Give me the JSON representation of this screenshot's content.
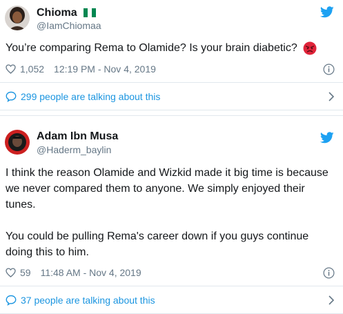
{
  "tweets": [
    {
      "name": "Chioma",
      "handle": "@IamChiomaa",
      "text": "You’re comparing Rema to Olamide? Is your brain diabetic?",
      "likes": "1,052",
      "timestamp": "12:19 PM - Nov 4, 2019",
      "talking": "299 people are talking about this"
    },
    {
      "name": "Adam Ibn Musa",
      "handle": "@Haderm_baylin",
      "text_lines": [
        "I think the reason Olamide and Wizkid made it big time is because",
        "we never compared them to anyone. We simply enjoyed their",
        "tunes.",
        "You could be pulling Rema's career down if you guys continue",
        "doing this to him."
      ],
      "likes": "59",
      "timestamp": "11:48 AM - Nov 4, 2019",
      "talking": "37 people are talking about this"
    }
  ],
  "icons": {
    "brand": "twitter-bird-icon",
    "like": "heart-icon",
    "info": "info-icon",
    "reply": "speech-bubble-icon",
    "more": "chevron-right-icon",
    "flag": "nigeria-flag-emoji",
    "angry": "angry-face-emoji"
  },
  "colors": {
    "twitter_blue": "#1da1f2",
    "link_blue": "#1b95e0",
    "meta_gray": "#657786",
    "border": "#e1e8ed",
    "flag_green": "#008751"
  }
}
